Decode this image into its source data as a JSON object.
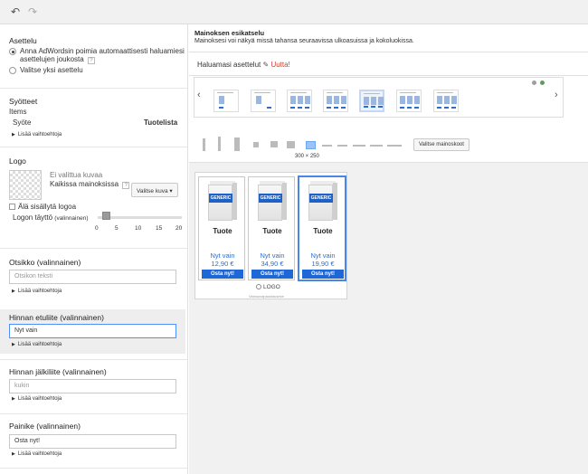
{
  "toolbar": {
    "undo_icon": "undo-icon",
    "redo_icon": "redo-icon"
  },
  "left": {
    "layout": {
      "title": "Asettelu",
      "option1": "Anna AdWordsin poimia automaattisesti haluamiesi",
      "option1_cont": "asettelujen joukosta",
      "option2": "Valitse yksi asettelu"
    },
    "feeds": {
      "title": "Syötteet",
      "items_label": "Items",
      "feed_label": "Syöte",
      "feed_value": "Tuotelista",
      "more": "Lisää vaihtoehtoja"
    },
    "logo": {
      "title": "Logo",
      "no_image": "Ei valittua kuvaa",
      "in_all_ads": "Kaikissa mainoksissa",
      "help": "?",
      "choose_image": "Valitse kuva",
      "exclude_logo": "Älä sisällytä logoa",
      "fill_label": "Logon täyttö",
      "fill_optional": "(valinnainen)",
      "fill_value": 2,
      "ticks": [
        "0",
        "5",
        "10",
        "15",
        "20"
      ]
    },
    "headline": {
      "title": "Otsikko (valinnainen)",
      "placeholder": "Otsikon teksti",
      "more": "Lisää vaihtoehtoja"
    },
    "price_prefix": {
      "title": "Hinnan etuliite (valinnainen)",
      "value": "Nyt vain",
      "more": "Lisää vaihtoehtoja"
    },
    "price_suffix": {
      "title": "Hinnan jälkiliite (valinnainen)",
      "placeholder": "kukin",
      "more": "Lisää vaihtoehtoja"
    },
    "button": {
      "title": "Painike (valinnainen)",
      "value": "Osta nyt!",
      "more": "Lisää vaihtoehtoja"
    }
  },
  "preview": {
    "title": "Mainoksen esikatselu",
    "subtitle": "Mainoksesi voi näkyä missä tahansa seuraavissa ulkoasuissa ja kokoluokissa.",
    "layouts_label": "Haluamasi asettelut",
    "new_label": "Uutta!",
    "size_label": "300 × 250",
    "choose_sizes": "Valitse mainoskoot",
    "ad": {
      "cards": [
        {
          "brand": "GENERIC",
          "name": "Tuote",
          "prefix": "Nyt vain",
          "price": "12,90 €",
          "cta": "Osta nyt!"
        },
        {
          "brand": "GENERIC",
          "name": "Tuote",
          "prefix": "Nyt vain",
          "price": "34,90 €",
          "cta": "Osta nyt!"
        },
        {
          "brand": "GENERIC",
          "name": "Tuote",
          "prefix": "Nyt vain",
          "price": "19,90 €",
          "cta": "Osta nyt!"
        }
      ],
      "logo_text": "LOGO",
      "footer": "Vastuuvapauslauseke"
    }
  },
  "colors": {
    "accent": "#1e67d6",
    "new": "#d23f31",
    "selection": "#4a86e8"
  }
}
